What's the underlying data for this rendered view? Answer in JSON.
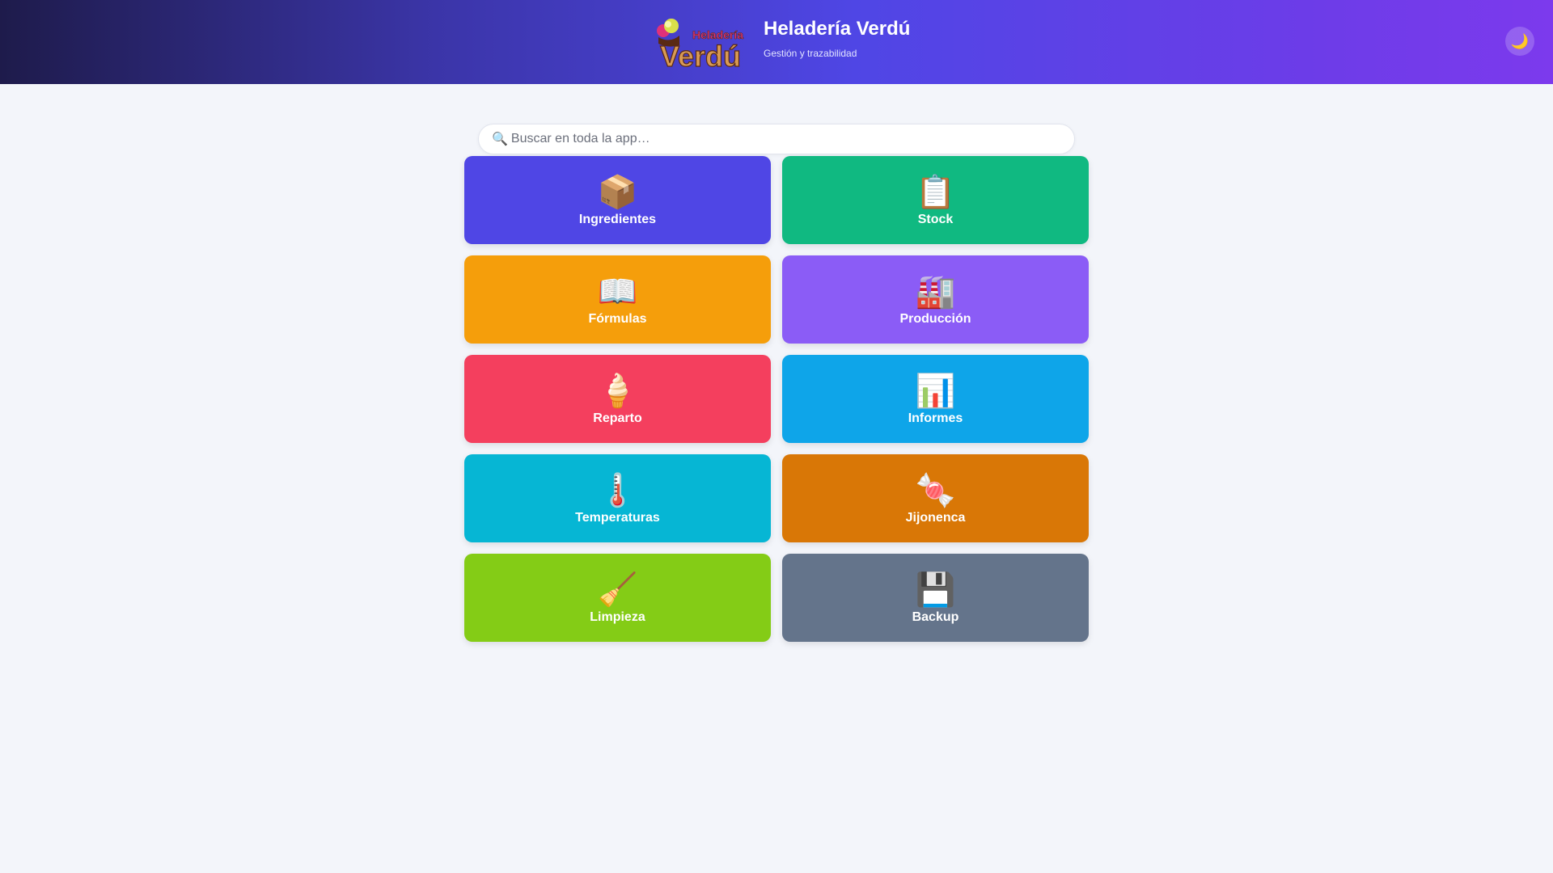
{
  "header": {
    "logo_text_top": "Heladería",
    "logo_text_main": "Verdú",
    "title": "Heladería Verdú",
    "subtitle": "Gestión y trazabilidad",
    "theme_toggle_icon": "🌙"
  },
  "search": {
    "icon": "🔍",
    "placeholder": "Buscar en toda la app…",
    "value": ""
  },
  "tiles": [
    {
      "icon": "📦",
      "label": "Ingredientes",
      "color": "#4f46e5"
    },
    {
      "icon": "📋",
      "label": "Stock",
      "color": "#10b981"
    },
    {
      "icon": "📖",
      "label": "Fórmulas",
      "color": "#f59e0b"
    },
    {
      "icon": "🏭",
      "label": "Producción",
      "color": "#8b5cf6"
    },
    {
      "icon": "🍦",
      "label": "Reparto",
      "color": "#f43f5e"
    },
    {
      "icon": "📊",
      "label": "Informes",
      "color": "#0ea5e9"
    },
    {
      "icon": "🌡️",
      "label": "Temperaturas",
      "color": "#06b6d4"
    },
    {
      "icon": "🍬",
      "label": "Jijonenca",
      "color": "#d97706"
    },
    {
      "icon": "🧹",
      "label": "Limpieza",
      "color": "#84cc16"
    },
    {
      "icon": "💾",
      "label": "Backup",
      "color": "#64748b"
    }
  ]
}
